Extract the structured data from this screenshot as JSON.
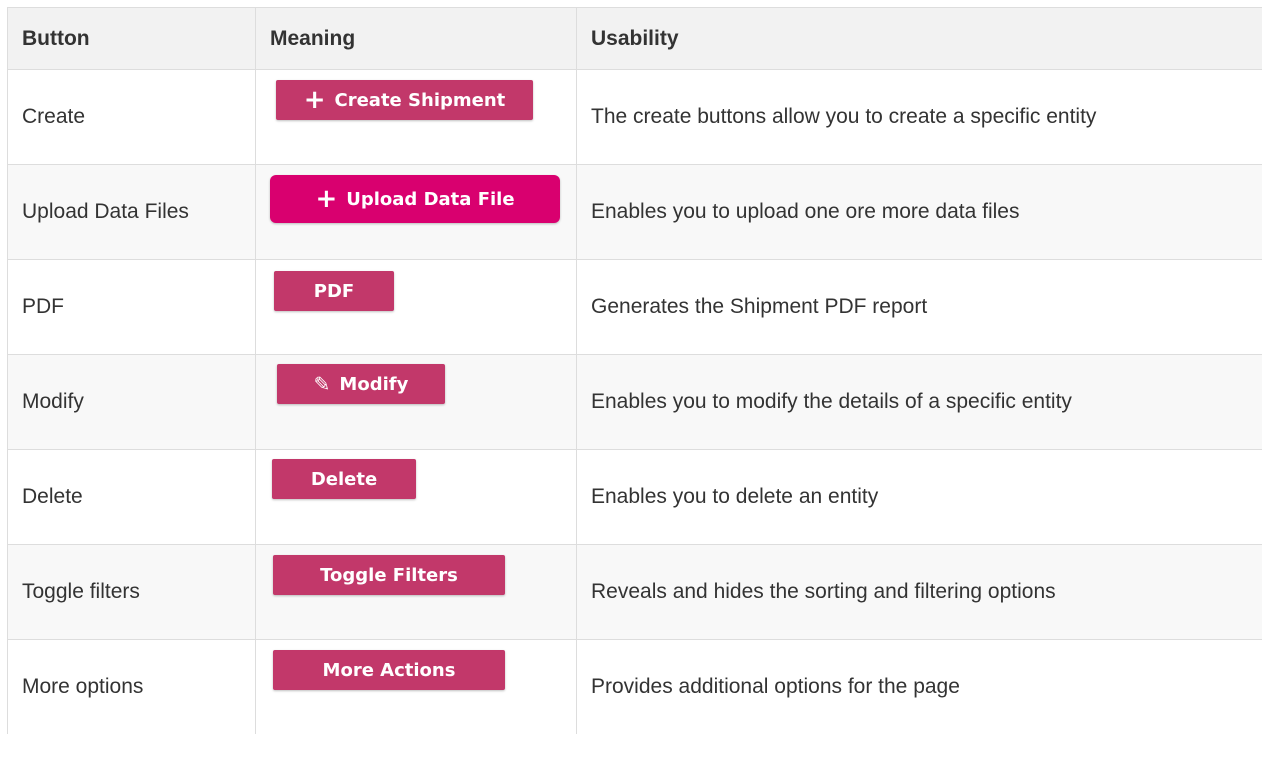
{
  "table": {
    "headers": [
      "Button",
      "Meaning",
      "Usability"
    ],
    "rows": [
      {
        "name": "Create",
        "button_label": "Create Shipment",
        "button_icon": "plus-icon",
        "usability": "The create buttons allow you to create a specific entity"
      },
      {
        "name": "Upload Data Files",
        "button_label": "Upload Data File",
        "button_icon": "plus-icon",
        "usability": "Enables you to upload one ore more data files"
      },
      {
        "name": "PDF",
        "button_label": "PDF",
        "button_icon": "",
        "usability": "Generates the Shipment PDF report"
      },
      {
        "name": "Modify",
        "button_label": "Modify",
        "button_icon": "pencil-icon",
        "usability": "Enables you to modify the details of a specific entity"
      },
      {
        "name": "Delete",
        "button_label": "Delete",
        "button_icon": "",
        "usability": "Enables you to delete an entity"
      },
      {
        "name": "Toggle filters",
        "button_label": "Toggle Filters",
        "button_icon": "",
        "usability": "Reveals and hides the sorting and filtering options"
      },
      {
        "name": "More options",
        "button_label": "More Actions",
        "button_icon": "",
        "usability": "Provides additional options for the page"
      }
    ]
  },
  "colors": {
    "button": "#c2386a",
    "button_bright": "#d9006f",
    "header_bg": "#f2f2f2",
    "border": "#dddddd",
    "text": "#333333"
  }
}
